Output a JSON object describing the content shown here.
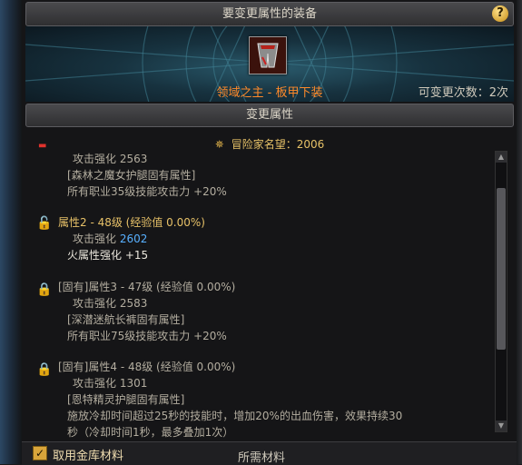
{
  "header": {
    "title": "要变更属性的装备",
    "help_icon": "?"
  },
  "equipment": {
    "name": "领域之主 - 板甲下装",
    "change_count": "可变更次数：2次"
  },
  "section": {
    "title": "变更属性"
  },
  "reputation": {
    "icon": "crest-icon",
    "text": "冒险家名望：2006"
  },
  "attributes": [
    {
      "header": null,
      "lines": [
        "攻击强化 2563",
        "[森林之魔女护腿固有属性]",
        "所有职业35级技能攻击力 +20%"
      ]
    },
    {
      "header": "属性2 - 48级 (经验值 0.00%)",
      "lines": [
        "攻击强化",
        "2602",
        "火属性强化 +15"
      ],
      "lock": "gold"
    },
    {
      "header": "[固有]属性3 - 47级 (经验值 0.00%)",
      "lines": [
        "攻击强化 2583",
        "[深潜迷航长裤固有属性]",
        "所有职业75级技能攻击力 +20%"
      ],
      "lock": "red"
    },
    {
      "header": "[固有]属性4 - 48级 (经验值 0.00%)",
      "lines": [
        "攻击强化 1301",
        "[恩特精灵护腿固有属性]",
        "施放冷却时间超过25秒的技能时，增加20%的出血伤害，效果持续30",
        "秒（冷却时间1秒，最多叠加1次）"
      ],
      "lock": "red"
    }
  ],
  "footer": {
    "use_storage_label": "取用金库材料",
    "materials_label": "所需材料",
    "use_storage_checked": true
  },
  "colors": {
    "accent_gold": "#e7c168",
    "item_orange": "#ff8a2a",
    "value_blue": "#58b0ff",
    "lock_red": "#e0322c"
  }
}
